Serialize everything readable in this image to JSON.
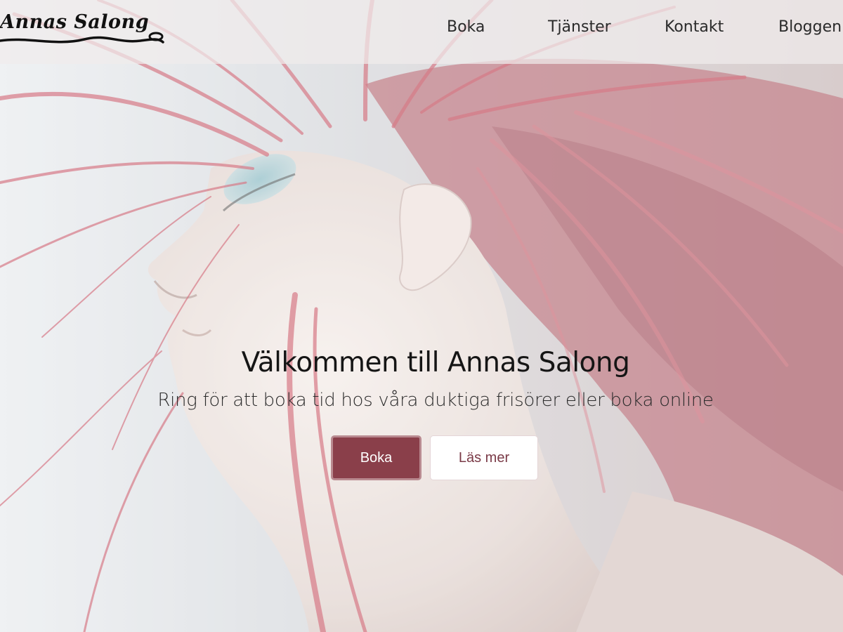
{
  "brand": {
    "logo_text": "Annas Salong"
  },
  "nav": {
    "items": [
      {
        "label": "Boka"
      },
      {
        "label": "Tjänster"
      },
      {
        "label": "Kontakt"
      },
      {
        "label": "Bloggen"
      }
    ]
  },
  "hero": {
    "title": "Välkommen till Annas Salong",
    "subtitle": "Ring för att boka tid hos våra duktiga frisörer eller boka online",
    "primary_button": "Boka",
    "secondary_button": "Läs mer"
  },
  "colors": {
    "primary": "#8a3f4a",
    "secondary_text": "#7a3a47",
    "hair": "#c8485a"
  }
}
